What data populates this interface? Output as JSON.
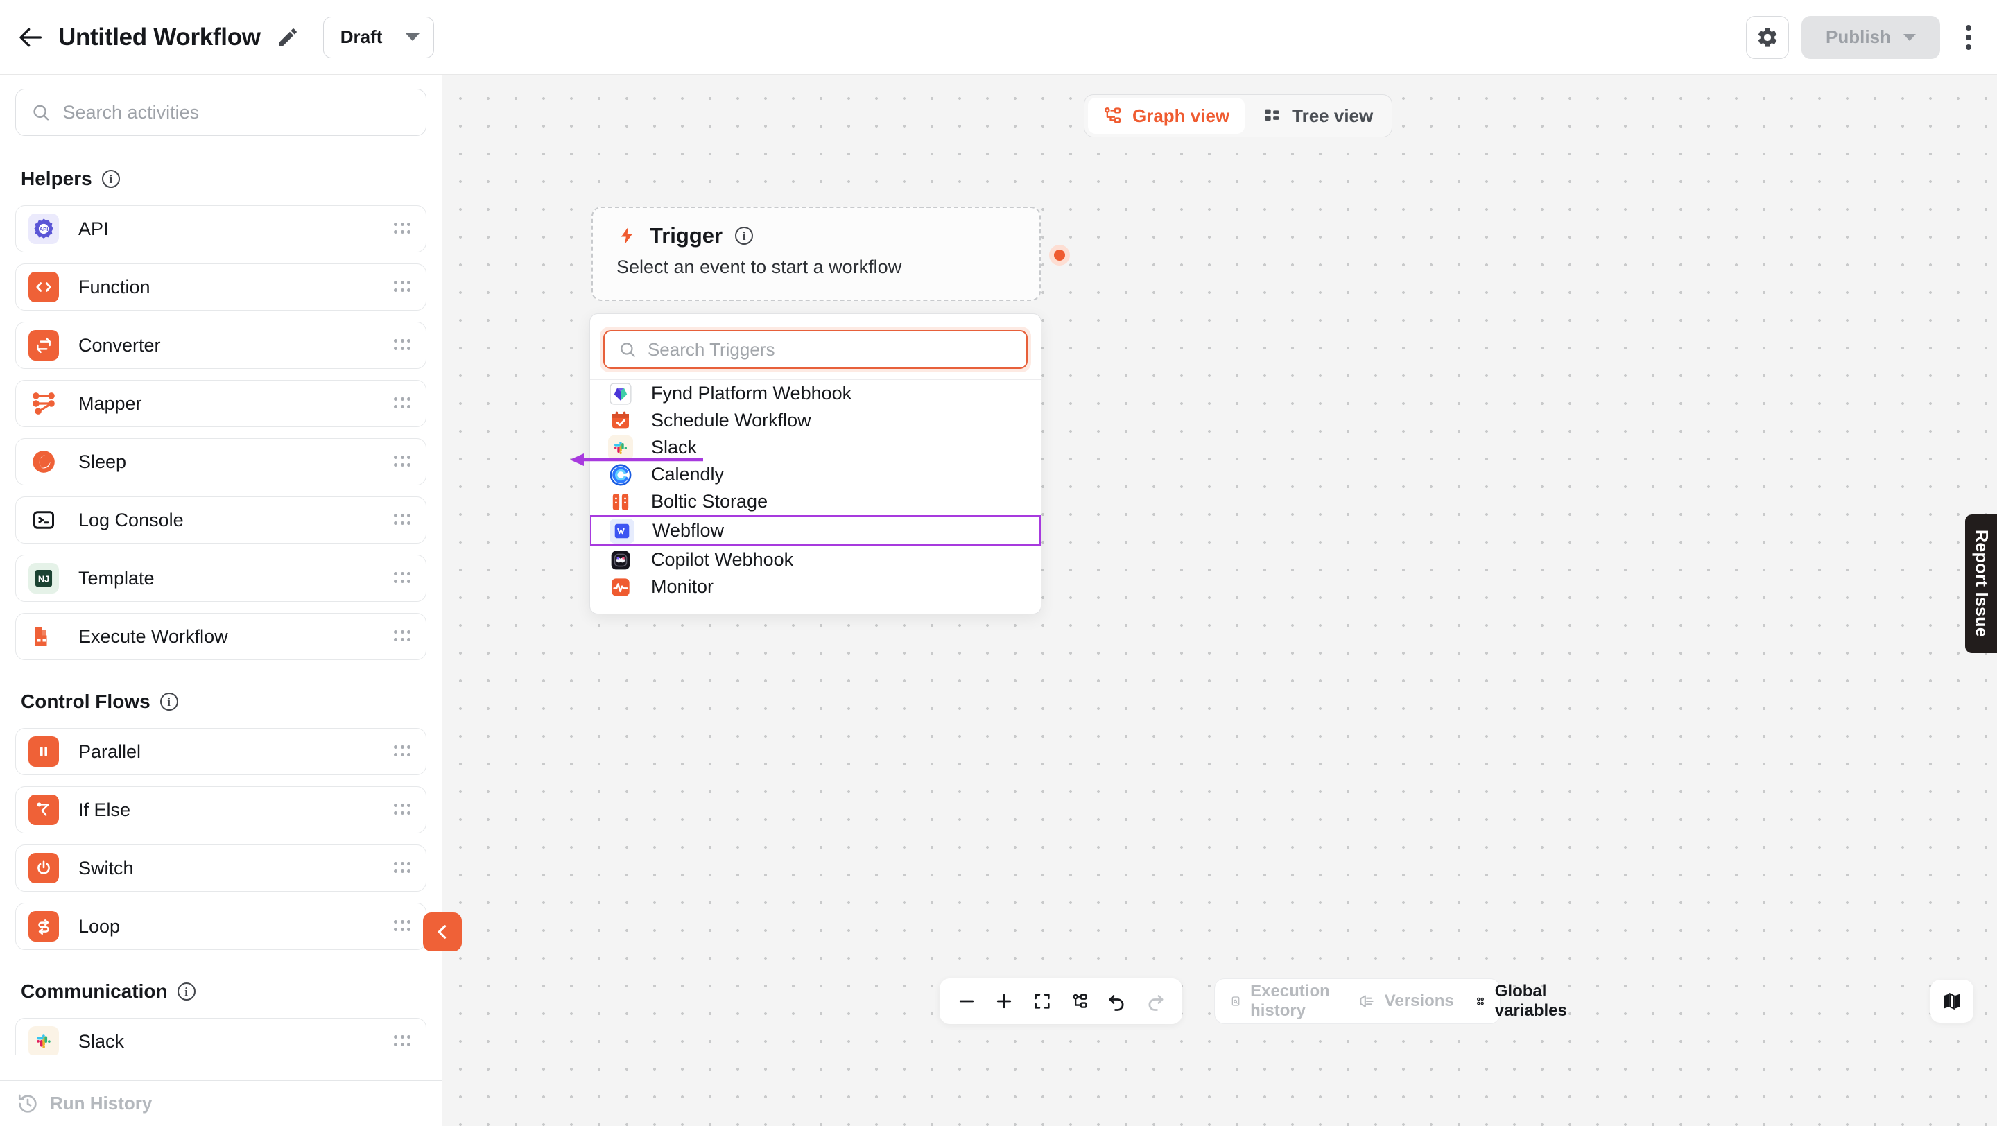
{
  "header": {
    "back_icon": "arrow-left-icon",
    "title": "Untitled Workflow",
    "edit_icon": "pencil-icon",
    "status": "Draft",
    "gear_icon": "gear-icon",
    "publish_label": "Publish",
    "kebab_icon": "more-vertical-icon"
  },
  "sidebar": {
    "search_placeholder": "Search activities",
    "groups": [
      {
        "title": "Helpers",
        "items": [
          {
            "label": "API",
            "icon": "api-icon"
          },
          {
            "label": "Function",
            "icon": "code-icon"
          },
          {
            "label": "Converter",
            "icon": "convert-icon"
          },
          {
            "label": "Mapper",
            "icon": "mapper-icon"
          },
          {
            "label": "Sleep",
            "icon": "moon-icon"
          },
          {
            "label": "Log Console",
            "icon": "terminal-icon"
          },
          {
            "label": "Template",
            "icon": "nunjucks-icon"
          },
          {
            "label": "Execute Workflow",
            "icon": "execute-workflow-icon"
          }
        ]
      },
      {
        "title": "Control Flows",
        "items": [
          {
            "label": "Parallel",
            "icon": "parallel-icon"
          },
          {
            "label": "If Else",
            "icon": "branch-icon"
          },
          {
            "label": "Switch",
            "icon": "power-icon"
          },
          {
            "label": "Loop",
            "icon": "loop-icon"
          }
        ]
      },
      {
        "title": "Communication",
        "items": [
          {
            "label": "Slack",
            "icon": "slack-icon"
          }
        ]
      }
    ],
    "run_history_label": "Run History",
    "run_history_icon": "history-icon",
    "collapse_icon": "chevron-left-icon"
  },
  "canvas": {
    "view_toggle": [
      {
        "label": "Graph view",
        "icon": "graph-icon",
        "active": true
      },
      {
        "label": "Tree view",
        "icon": "tree-icon",
        "active": false
      }
    ],
    "trigger_node": {
      "icon": "bolt-icon",
      "title": "Trigger",
      "info_icon": "info-icon",
      "subtitle": "Select an event to start a workflow"
    },
    "trigger_dropdown": {
      "search_placeholder": "Search Triggers",
      "search_icon": "search-icon",
      "items": [
        {
          "label": "Fynd Platform Webhook",
          "icon": "fynd-icon",
          "highlighted": false
        },
        {
          "label": "Schedule Workflow",
          "icon": "calendar-check-icon",
          "highlighted": false
        },
        {
          "label": "Slack",
          "icon": "slack-icon",
          "highlighted": false
        },
        {
          "label": "Calendly",
          "icon": "calendly-icon",
          "highlighted": false
        },
        {
          "label": "Boltic Storage",
          "icon": "boltic-storage-icon",
          "highlighted": false
        },
        {
          "label": "Webflow",
          "icon": "webflow-icon",
          "highlighted": true
        },
        {
          "label": "Copilot Webhook",
          "icon": "copilot-icon",
          "highlighted": false
        },
        {
          "label": "Monitor",
          "icon": "monitor-pulse-icon",
          "highlighted": false
        }
      ]
    },
    "zoom_bar": [
      {
        "icon": "zoom-out-icon"
      },
      {
        "icon": "zoom-in-icon"
      },
      {
        "icon": "fit-screen-icon"
      },
      {
        "icon": "auto-layout-icon"
      },
      {
        "icon": "undo-icon"
      },
      {
        "icon": "redo-icon"
      }
    ],
    "meta_bar": [
      {
        "label": "Execution history",
        "icon": "execution-history-icon",
        "state": "disabled"
      },
      {
        "label": "Versions",
        "icon": "versions-icon",
        "state": "disabled"
      },
      {
        "label": "Global variables",
        "icon": "global-variables-icon",
        "state": "enabled"
      }
    ],
    "map_icon": "map-icon"
  },
  "report_issue": {
    "label": "Report Issue"
  },
  "colors": {
    "accent": "#ef6137",
    "accent_text": "#ef5b30",
    "highlight": "#a73ade",
    "canvas_bg": "#f4f4f4",
    "dot_grid": "#c9cacb"
  }
}
